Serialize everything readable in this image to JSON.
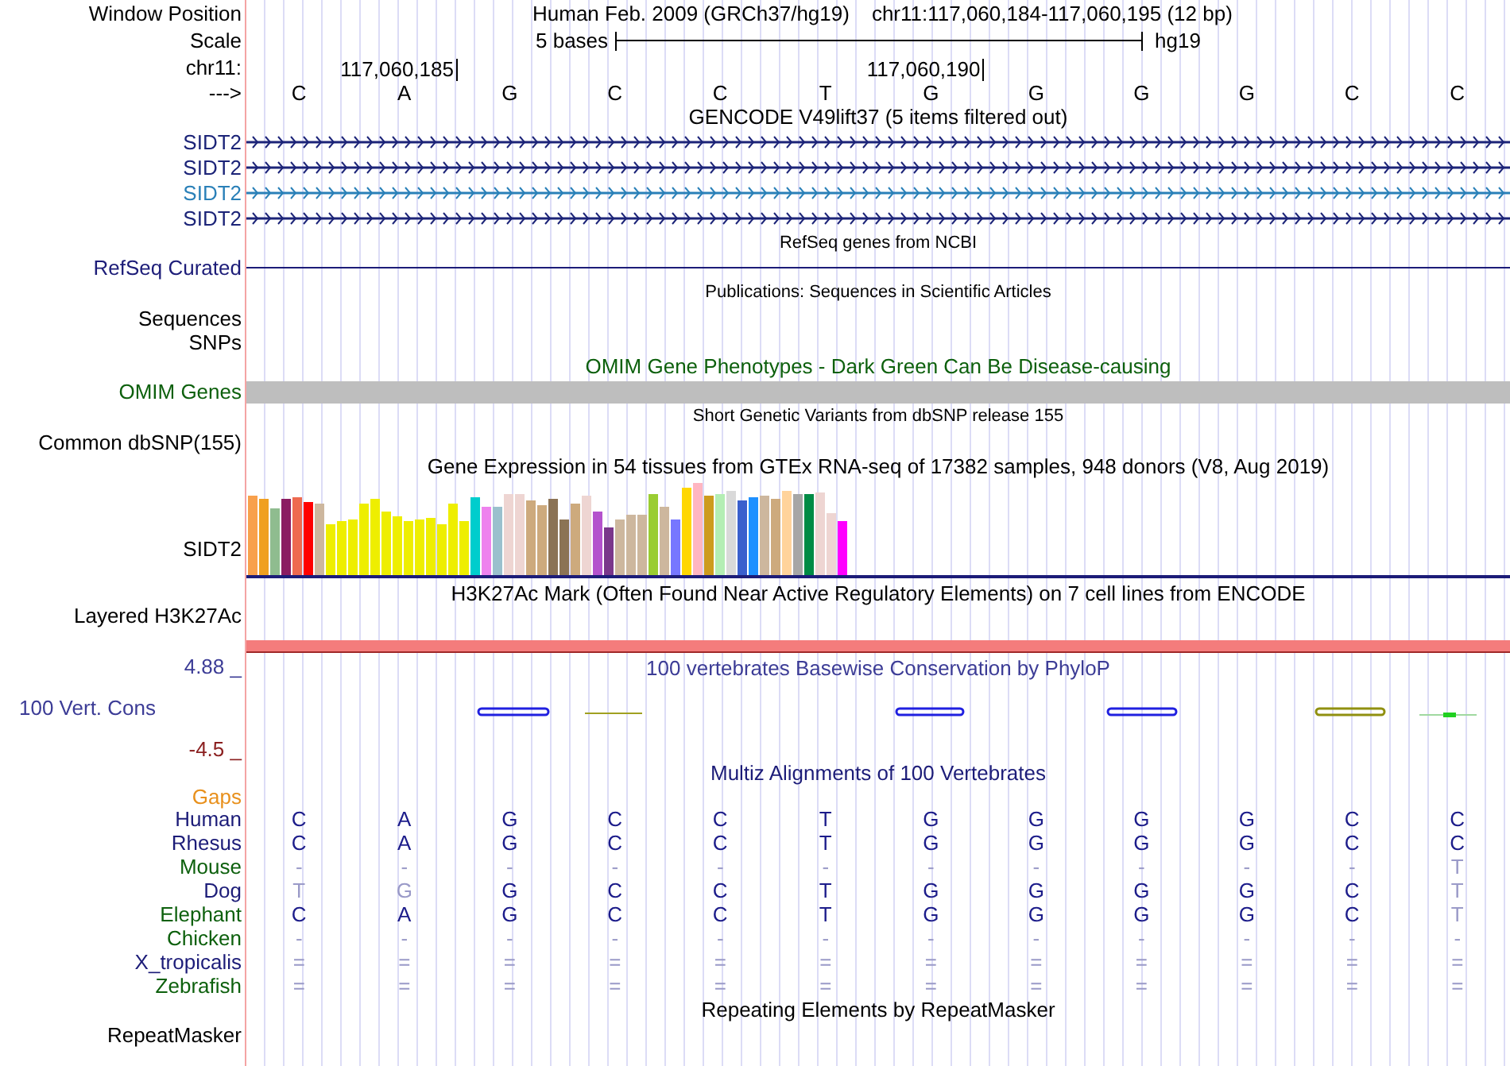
{
  "header": {
    "window_position_label": "Window Position",
    "assembly": "Human Feb. 2009 (GRCh37/hg19)",
    "position": "chr11:117,060,184-117,060,195 (12 bp)",
    "scale_label": "Scale",
    "scale_text": "5 bases",
    "scale_db": "hg19",
    "chrom_label": "chr11:",
    "ticks": [
      "117,060,185",
      "117,060,190"
    ],
    "strand_label": "--->",
    "bases": [
      "C",
      "A",
      "G",
      "C",
      "C",
      "T",
      "G",
      "G",
      "G",
      "G",
      "C",
      "C"
    ]
  },
  "tracks": [
    {
      "kind": "gene",
      "title": "GENCODE V49lift37 (5 items filtered out)",
      "items": [
        {
          "name": "SIDT2",
          "color": "#1c2478"
        },
        {
          "name": "SIDT2",
          "color": "#1c2478"
        },
        {
          "name": "SIDT2",
          "color": "#2a80b8"
        },
        {
          "name": "SIDT2",
          "color": "#1c2478"
        }
      ]
    },
    {
      "kind": "refseq",
      "title": "RefSeq genes from NCBI",
      "label": "RefSeq Curated"
    },
    {
      "kind": "publications",
      "title": "Publications: Sequences in Scientific Articles",
      "labels": [
        "Sequences",
        "SNPs"
      ]
    },
    {
      "kind": "omim",
      "title": "OMIM Gene Phenotypes - Dark Green Can Be Disease-causing",
      "label": "OMIM Genes"
    },
    {
      "kind": "dbsnp",
      "title": "Short Genetic Variants from dbSNP release 155",
      "label": "Common dbSNP(155)"
    },
    {
      "kind": "gtex",
      "title": "Gene Expression in 54 tissues from GTEx RNA-seq of 17382 samples, 948 donors (V8, Aug 2019)",
      "label": "SIDT2"
    },
    {
      "kind": "h3k27ac",
      "title": "H3K27Ac Mark (Often Found Near Active Regulatory Elements) on 7 cell lines from ENCODE",
      "label": "Layered H3K27Ac"
    },
    {
      "kind": "phylop",
      "title": "100 vertebrates Basewise Conservation by PhyloP",
      "label": "100 Vert. Cons",
      "max": "4.88 _",
      "min": "-4.5 _"
    },
    {
      "kind": "multiz",
      "title": "Multiz Alignments of 100 Vertebrates",
      "gaps_label": "Gaps",
      "species": [
        {
          "name": "Human",
          "color": "#1c1c78",
          "bases": [
            "C",
            "A",
            "G",
            "C",
            "C",
            "T",
            "G",
            "G",
            "G",
            "G",
            "C",
            "C"
          ],
          "faded": [
            false,
            false,
            false,
            false,
            false,
            false,
            false,
            false,
            false,
            false,
            false,
            false
          ]
        },
        {
          "name": "Rhesus",
          "color": "#1c1c78",
          "bases": [
            "C",
            "A",
            "G",
            "C",
            "C",
            "T",
            "G",
            "G",
            "G",
            "G",
            "C",
            "C"
          ],
          "faded": [
            false,
            false,
            false,
            false,
            false,
            false,
            false,
            false,
            false,
            false,
            false,
            false
          ]
        },
        {
          "name": "Mouse",
          "color": "#0d600d",
          "bases": [
            "-",
            "-",
            "-",
            "-",
            "-",
            "-",
            "-",
            "-",
            "-",
            "-",
            "-",
            "T"
          ],
          "faded": [
            true,
            true,
            true,
            true,
            true,
            true,
            true,
            true,
            true,
            true,
            true,
            true
          ]
        },
        {
          "name": "Dog",
          "color": "#1c1c78",
          "bases": [
            "T",
            "G",
            "G",
            "C",
            "C",
            "T",
            "G",
            "G",
            "G",
            "G",
            "C",
            "T"
          ],
          "faded": [
            true,
            true,
            false,
            false,
            false,
            false,
            false,
            false,
            false,
            false,
            false,
            true
          ]
        },
        {
          "name": "Elephant",
          "color": "#0d600d",
          "bases": [
            "C",
            "A",
            "G",
            "C",
            "C",
            "T",
            "G",
            "G",
            "G",
            "G",
            "C",
            "T"
          ],
          "faded": [
            false,
            false,
            false,
            false,
            false,
            false,
            false,
            false,
            false,
            false,
            false,
            true
          ]
        },
        {
          "name": "Chicken",
          "color": "#0d600d",
          "bases": [
            "-",
            "-",
            "-",
            "-",
            "-",
            "-",
            "-",
            "-",
            "-",
            "-",
            "-",
            "-"
          ],
          "faded": [
            true,
            true,
            true,
            true,
            true,
            true,
            true,
            true,
            true,
            true,
            true,
            true
          ]
        },
        {
          "name": "X_tropicalis",
          "color": "#1c1c78",
          "bases": [
            "=",
            "=",
            "=",
            "=",
            "=",
            "=",
            "=",
            "=",
            "=",
            "=",
            "=",
            "="
          ],
          "faded": [
            true,
            true,
            true,
            true,
            true,
            true,
            true,
            true,
            true,
            true,
            true,
            true
          ]
        },
        {
          "name": "Zebrafish",
          "color": "#0d600d",
          "bases": [
            "=",
            "=",
            "=",
            "=",
            "=",
            "=",
            "=",
            "=",
            "=",
            "=",
            "=",
            "="
          ],
          "faded": [
            true,
            true,
            true,
            true,
            true,
            true,
            true,
            true,
            true,
            true,
            true,
            true
          ]
        }
      ]
    },
    {
      "kind": "repeatmasker",
      "title": "Repeating Elements by RepeatMasker",
      "label": "RepeatMasker"
    }
  ]
}
